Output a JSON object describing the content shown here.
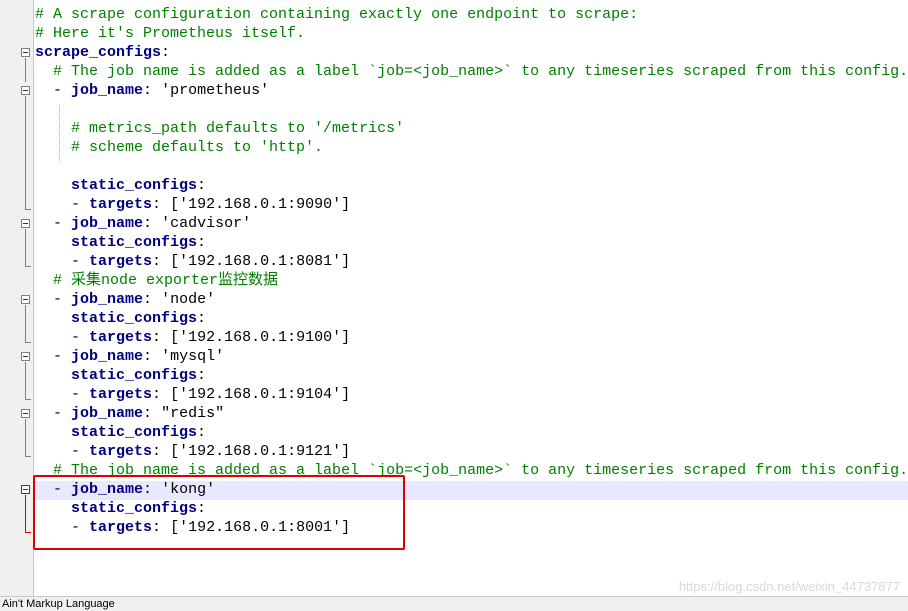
{
  "editor": {
    "language": "Ain't Markup Language",
    "lines": [
      {
        "t": [
          [
            "comment",
            "# A scrape configuration containing exactly one endpoint to scrape:"
          ]
        ]
      },
      {
        "t": [
          [
            "comment",
            "# Here it's Prometheus itself."
          ]
        ]
      },
      {
        "t": [
          [
            "key",
            "scrape_configs"
          ],
          [
            "punct",
            ":"
          ]
        ]
      },
      {
        "t": [
          [
            "plain",
            "  "
          ],
          [
            "comment",
            "# The job name is added as a label `job=<job_name>` to any timeseries scraped from this config."
          ]
        ]
      },
      {
        "t": [
          [
            "plain",
            "  "
          ],
          [
            "punct",
            "- "
          ],
          [
            "key",
            "job_name"
          ],
          [
            "punct",
            ": "
          ],
          [
            "str",
            "'prometheus'"
          ]
        ]
      },
      {
        "t": [
          [
            "plain",
            ""
          ]
        ]
      },
      {
        "t": [
          [
            "plain",
            "    "
          ],
          [
            "comment",
            "# metrics_path defaults to '/metrics'"
          ]
        ]
      },
      {
        "t": [
          [
            "plain",
            "    "
          ],
          [
            "comment",
            "# scheme defaults to 'http'."
          ]
        ]
      },
      {
        "t": [
          [
            "plain",
            ""
          ]
        ]
      },
      {
        "t": [
          [
            "plain",
            "    "
          ],
          [
            "key",
            "static_configs"
          ],
          [
            "punct",
            ":"
          ]
        ]
      },
      {
        "t": [
          [
            "plain",
            "    "
          ],
          [
            "punct",
            "- "
          ],
          [
            "key",
            "targets"
          ],
          [
            "punct",
            ": "
          ],
          [
            "str",
            "['192.168.0.1:9090']"
          ]
        ]
      },
      {
        "t": [
          [
            "plain",
            "  "
          ],
          [
            "punct",
            "- "
          ],
          [
            "key",
            "job_name"
          ],
          [
            "punct",
            ": "
          ],
          [
            "str",
            "'cadvisor'"
          ]
        ]
      },
      {
        "t": [
          [
            "plain",
            "    "
          ],
          [
            "key",
            "static_configs"
          ],
          [
            "punct",
            ":"
          ]
        ]
      },
      {
        "t": [
          [
            "plain",
            "    "
          ],
          [
            "punct",
            "- "
          ],
          [
            "key",
            "targets"
          ],
          [
            "punct",
            ": "
          ],
          [
            "str",
            "['192.168.0.1:8081']"
          ]
        ]
      },
      {
        "t": [
          [
            "plain",
            "  "
          ],
          [
            "comment",
            "# 采集node exporter监控数据"
          ]
        ]
      },
      {
        "t": [
          [
            "plain",
            "  "
          ],
          [
            "punct",
            "- "
          ],
          [
            "key",
            "job_name"
          ],
          [
            "punct",
            ": "
          ],
          [
            "str",
            "'node'"
          ]
        ]
      },
      {
        "t": [
          [
            "plain",
            "    "
          ],
          [
            "key",
            "static_configs"
          ],
          [
            "punct",
            ":"
          ]
        ]
      },
      {
        "t": [
          [
            "plain",
            "    "
          ],
          [
            "punct",
            "- "
          ],
          [
            "key",
            "targets"
          ],
          [
            "punct",
            ": "
          ],
          [
            "str",
            "['192.168.0.1:9100']"
          ]
        ]
      },
      {
        "t": [
          [
            "plain",
            "  "
          ],
          [
            "punct",
            "- "
          ],
          [
            "key",
            "job_name"
          ],
          [
            "punct",
            ": "
          ],
          [
            "str",
            "'mysql'"
          ]
        ]
      },
      {
        "t": [
          [
            "plain",
            "    "
          ],
          [
            "key",
            "static_configs"
          ],
          [
            "punct",
            ":"
          ]
        ]
      },
      {
        "t": [
          [
            "plain",
            "    "
          ],
          [
            "punct",
            "- "
          ],
          [
            "key",
            "targets"
          ],
          [
            "punct",
            ": "
          ],
          [
            "str",
            "['192.168.0.1:9104']"
          ]
        ]
      },
      {
        "t": [
          [
            "plain",
            "  "
          ],
          [
            "punct",
            "- "
          ],
          [
            "key",
            "job_name"
          ],
          [
            "punct",
            ": "
          ],
          [
            "str",
            "\"redis\""
          ]
        ]
      },
      {
        "t": [
          [
            "plain",
            "    "
          ],
          [
            "key",
            "static_configs"
          ],
          [
            "punct",
            ":"
          ]
        ]
      },
      {
        "t": [
          [
            "plain",
            "    "
          ],
          [
            "punct",
            "- "
          ],
          [
            "key",
            "targets"
          ],
          [
            "punct",
            ": "
          ],
          [
            "str",
            "['192.168.0.1:9121']"
          ]
        ]
      },
      {
        "t": [
          [
            "plain",
            "  "
          ],
          [
            "comment",
            "# The job name is added as a label `job=<job_name>` to any timeseries scraped from this config."
          ]
        ]
      },
      {
        "t": [
          [
            "plain",
            "  "
          ],
          [
            "punct",
            "- "
          ],
          [
            "key",
            "job_name"
          ],
          [
            "punct",
            ": "
          ],
          [
            "str",
            "'kong'"
          ]
        ]
      },
      {
        "t": [
          [
            "plain",
            "    "
          ],
          [
            "key",
            "static_configs"
          ],
          [
            "punct",
            ":"
          ]
        ]
      },
      {
        "t": [
          [
            "plain",
            "    "
          ],
          [
            "punct",
            "- "
          ],
          [
            "key",
            "targets"
          ],
          [
            "punct",
            ": "
          ],
          [
            "str",
            "['192.168.0.1:8001']"
          ]
        ]
      }
    ]
  },
  "watermark": "https://blog.csdn.net/weixin_44737877",
  "colors": {
    "comment": "#008000",
    "key": "#000080",
    "highlight_box": "#e00000",
    "current_line": "#e8e8ff"
  }
}
